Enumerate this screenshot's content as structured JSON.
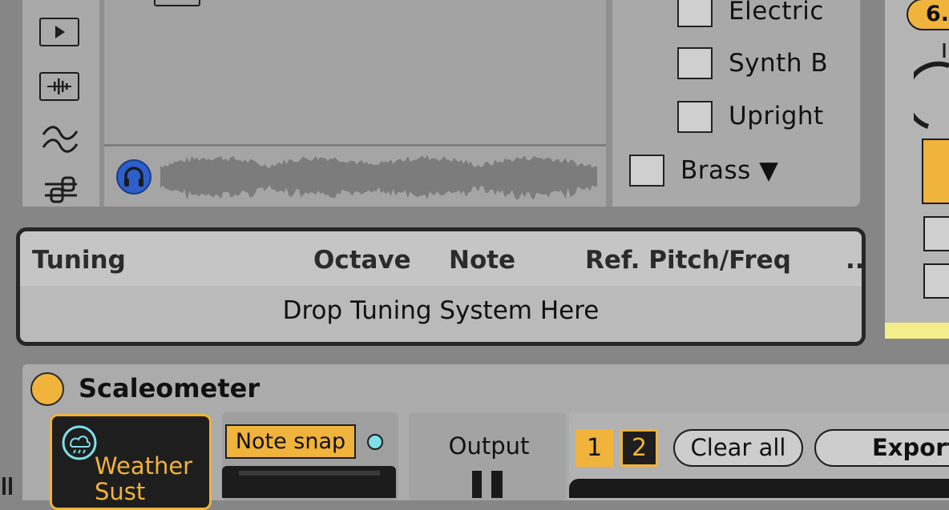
{
  "browser": {
    "sidebar_icons": [
      "play-icon",
      "waveform-sample-icon",
      "wave-icon",
      "mixer-icon"
    ],
    "headphone_icon": "headphones-icon",
    "instruments": [
      {
        "label": "Electric",
        "checked": false
      },
      {
        "label": "Synth B",
        "checked": false
      },
      {
        "label": "Upright",
        "checked": false
      }
    ],
    "brass": {
      "label": "Brass ▼",
      "checked": false
    }
  },
  "right_device": {
    "value_label": "6."
  },
  "tuning": {
    "columns": [
      "Tuning",
      "Octave",
      "Note",
      "Ref. Pitch/Freq",
      ".."
    ],
    "drop_text": "Drop Tuning System Here"
  },
  "device": {
    "title": "Scaleometer",
    "weather_label": "Weather",
    "weather_label_2": "Sust",
    "note_snap": "Note snap",
    "output_label": "Output",
    "bank_1": "1",
    "bank_2": "2",
    "clear_all": "Clear all",
    "export": "Export"
  },
  "colors": {
    "accent": "#f0b33b",
    "blue": "#2c5fcc",
    "indicator": "#7fdfe8"
  }
}
